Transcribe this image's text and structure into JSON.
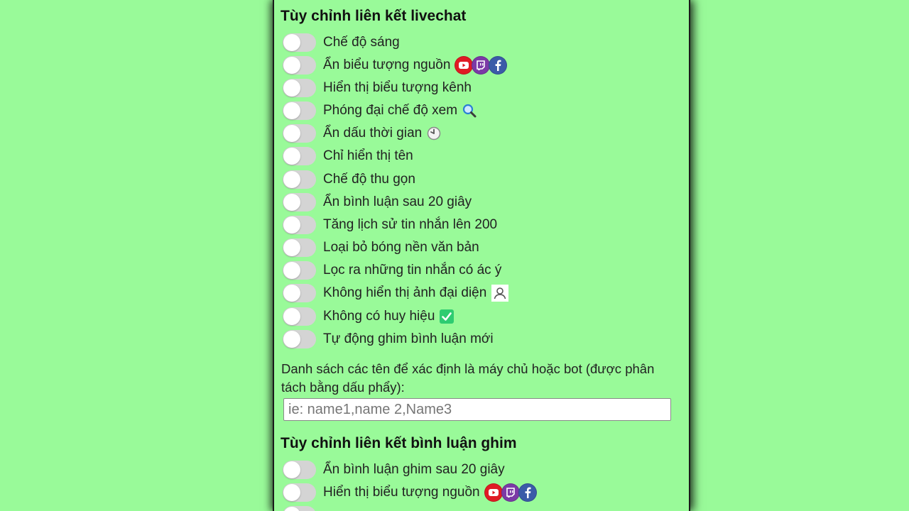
{
  "section1": {
    "title": "Tùy chỉnh liên kết livechat",
    "options": [
      {
        "label": "Chế độ sáng",
        "enabled": false
      },
      {
        "label": "Ẩn biểu tượng nguồn",
        "enabled": false,
        "icon": "source-icons"
      },
      {
        "label": "Hiển thị biểu tượng kênh",
        "enabled": false
      },
      {
        "label": "Phóng đại chế độ xem",
        "enabled": false,
        "icon": "magnifier-icon"
      },
      {
        "label": "Ẩn dấu thời gian",
        "enabled": false,
        "icon": "clock-icon"
      },
      {
        "label": "Chỉ hiển thị tên",
        "enabled": false
      },
      {
        "label": "Chế độ thu gọn",
        "enabled": false
      },
      {
        "label": "Ẩn bình luận sau 20 giây",
        "enabled": false
      },
      {
        "label": "Tăng lịch sử tin nhắn lên 200",
        "enabled": false
      },
      {
        "label": "Loại bỏ bóng nền văn bản",
        "enabled": false
      },
      {
        "label": "Lọc ra những tin nhắn có ác ý",
        "enabled": false
      },
      {
        "label": "Không hiển thị ảnh đại diện",
        "enabled": false,
        "icon": "user-avatar-icon"
      },
      {
        "label": "Không có huy hiệu",
        "enabled": false,
        "icon": "check-badge-icon"
      },
      {
        "label": "Tự động ghim bình luận mới",
        "enabled": false
      }
    ],
    "hosts_label": "Danh sách các tên để xác định là máy chủ hoặc bot (được phân tách bằng dấu phẩy):",
    "hosts_input": {
      "value": "",
      "placeholder": "ie: name1,name 2,Name3"
    }
  },
  "section2": {
    "title": "Tùy chỉnh liên kết bình luận ghim",
    "options": [
      {
        "label": "Ẩn bình luận ghim sau 20 giây",
        "enabled": false
      },
      {
        "label": "Hiển thị biểu tượng nguồn",
        "enabled": false,
        "icon": "source-icons"
      },
      {
        "label": "",
        "enabled": false
      }
    ]
  },
  "colors": {
    "background": "#99fa99",
    "toggle_off": "#d4d4d4",
    "youtube": "#e01b24",
    "twitch": "#7b3aa6",
    "facebook": "#3b5ba8",
    "check_badge": "#2ecc71"
  }
}
